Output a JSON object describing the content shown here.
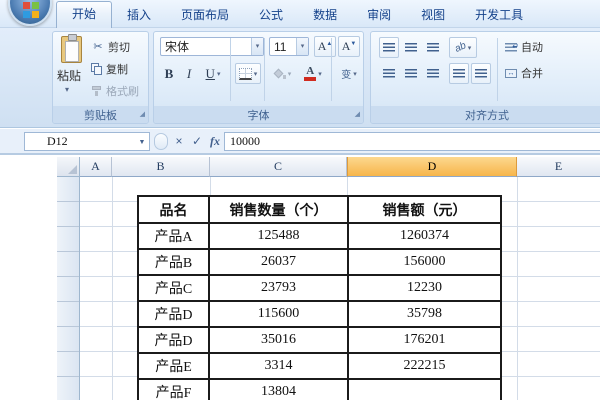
{
  "tabs": {
    "items": [
      {
        "label": "开始",
        "active": true
      },
      {
        "label": "插入",
        "active": false
      },
      {
        "label": "页面布局",
        "active": false
      },
      {
        "label": "公式",
        "active": false
      },
      {
        "label": "数据",
        "active": false
      },
      {
        "label": "审阅",
        "active": false
      },
      {
        "label": "视图",
        "active": false
      },
      {
        "label": "开发工具",
        "active": false
      }
    ]
  },
  "ribbon": {
    "clipboard": {
      "label": "剪贴板",
      "paste": "粘贴",
      "cut": "剪切",
      "copy": "复制",
      "format_painter": "格式刷"
    },
    "font": {
      "label": "字体",
      "font_name": "宋体",
      "font_size": "11",
      "bold": "B",
      "italic": "I",
      "underline": "U",
      "grow_letter": "A",
      "shrink_letter": "A",
      "color_letter": "A",
      "phonetic": "变"
    },
    "alignment": {
      "label": "对齐方式",
      "wrap_text": "自动",
      "merge": "合并",
      "orientation": "ab"
    }
  },
  "formula_bar": {
    "name_box": "D12",
    "cancel": "×",
    "enter": "✓",
    "function": "fx",
    "value": "10000"
  },
  "grid": {
    "columns": [
      "A",
      "B",
      "C",
      "D",
      "E"
    ],
    "selected_column": "D"
  },
  "table": {
    "headers": [
      "品名",
      "销售数量（个）",
      "销售额（元）"
    ],
    "rows": [
      [
        "产品A",
        "125488",
        "1260374"
      ],
      [
        "产品B",
        "26037",
        "156000"
      ],
      [
        "产品C",
        "23793",
        "12230"
      ],
      [
        "产品D",
        "115600",
        "35798"
      ],
      [
        "产品D",
        "35016",
        "176201"
      ],
      [
        "产品E",
        "3314",
        "222215"
      ],
      [
        "产品F",
        "13804",
        ""
      ]
    ]
  },
  "icons": {
    "dropdown": "▾",
    "namebox_dropdown": "▼",
    "cut_glyph": "✂",
    "launcher_glyph": "◢",
    "merge_glyph": "↔"
  },
  "colors": {
    "selected_column_fill": "#f7b54a",
    "active_tab_text": "#15428b",
    "table_border": "#1b1b1b",
    "grid_line": "#d3dce8",
    "font_color_bar": "#d02b20",
    "ribbon_bg": "#d6e5f5"
  }
}
